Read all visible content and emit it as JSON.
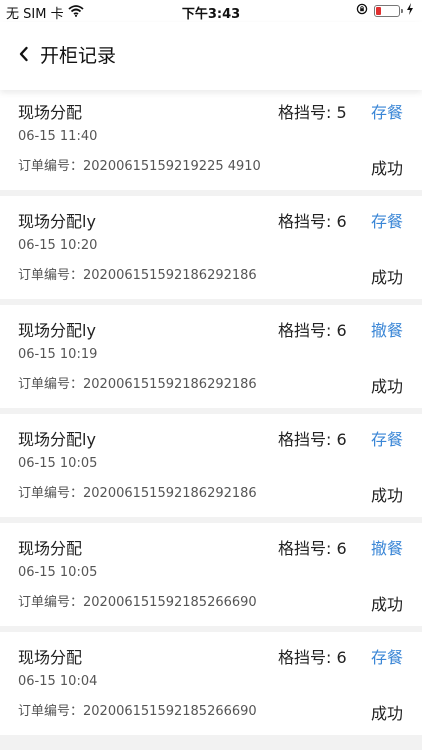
{
  "status_bar": {
    "carrier": "无 SIM 卡",
    "time": "下午3:43",
    "battery_color": "#e03030"
  },
  "header": {
    "back_icon": "chevron-left-icon",
    "title": "开柜记录"
  },
  "colors": {
    "action_blue": "#3a86d6",
    "background": "#f2f2f2"
  },
  "records": [
    {
      "title": "现场分配",
      "slot": "格挡号: 5",
      "action": "存餐",
      "time": "06-15 11:40",
      "order": "订单编号：20200615159219225 4910",
      "status": "成功"
    },
    {
      "title": "现场分配ly",
      "slot": "格挡号: 6",
      "action": "存餐",
      "time": "06-15 10:20",
      "order": "订单编号：202006151592186292186",
      "status": "成功"
    },
    {
      "title": "现场分配ly",
      "slot": "格挡号: 6",
      "action": "撤餐",
      "time": "06-15 10:19",
      "order": "订单编号：202006151592186292186",
      "status": "成功"
    },
    {
      "title": "现场分配ly",
      "slot": "格挡号: 6",
      "action": "存餐",
      "time": "06-15 10:05",
      "order": "订单编号：202006151592186292186",
      "status": "成功"
    },
    {
      "title": "现场分配",
      "slot": "格挡号: 6",
      "action": "撤餐",
      "time": "06-15 10:05",
      "order": "订单编号：202006151592185266690",
      "status": "成功"
    },
    {
      "title": "现场分配",
      "slot": "格挡号: 6",
      "action": "存餐",
      "time": "06-15 10:04",
      "order": "订单编号：202006151592185266690",
      "status": "成功"
    }
  ]
}
